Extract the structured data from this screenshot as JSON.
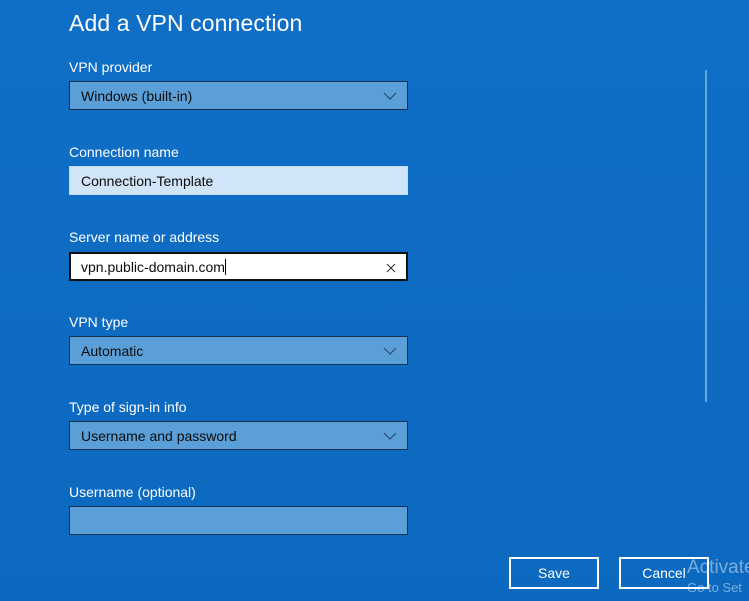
{
  "dialog": {
    "title": "Add a VPN connection"
  },
  "fields": {
    "vpn_provider": {
      "label": "VPN provider",
      "value": "Windows (built-in)",
      "icon": "chevron-down-icon"
    },
    "connection_name": {
      "label": "Connection name",
      "value": "Connection-Template"
    },
    "server_name": {
      "label": "Server name or address",
      "value": "vpn.public-domain.com",
      "icon": "clear-icon"
    },
    "vpn_type": {
      "label": "VPN type",
      "value": "Automatic",
      "icon": "chevron-down-icon"
    },
    "sign_in_type": {
      "label": "Type of sign-in info",
      "value": "Username and password",
      "icon": "chevron-down-icon"
    },
    "username": {
      "label": "Username (optional)",
      "value": ""
    }
  },
  "buttons": {
    "save_label": "Save",
    "cancel_label": "Cancel"
  },
  "watermark": {
    "line1": "Activate",
    "line2": "Go to Set"
  },
  "colors": {
    "background": "#0d6bc2",
    "field_fill": "#5b9fd9",
    "filled_textbox": "#d0e5f8",
    "focused_textbox": "#ffffff",
    "text": "#ffffff"
  }
}
